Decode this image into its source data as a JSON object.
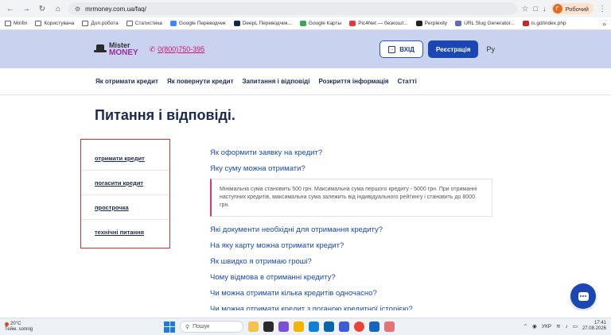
{
  "browser": {
    "url": "mrmoney.com.ua/faq/",
    "profile_initial": "Г",
    "profile_label": "Робочий",
    "bookmarks": [
      {
        "label": "Minfin",
        "kind": "folder"
      },
      {
        "label": "Користувача",
        "kind": "folder"
      },
      {
        "label": "Доп.робота",
        "kind": "folder"
      },
      {
        "label": "Статистика",
        "kind": "folder"
      },
      {
        "label": "Google Переводчик",
        "kind": "site",
        "color": "#4285f4"
      },
      {
        "label": "DeepL Переводчик...",
        "kind": "site",
        "color": "#0f2b46"
      },
      {
        "label": "Google Карты",
        "kind": "site",
        "color": "#34a853"
      },
      {
        "label": "Pic4Net — безкошт...",
        "kind": "site",
        "color": "#e53935"
      },
      {
        "label": "Perplexity",
        "kind": "site",
        "color": "#222222"
      },
      {
        "label": "URL Slug Generator...",
        "kind": "site",
        "color": "#5c6bc0"
      },
      {
        "label": "is.gd/index.php",
        "kind": "site",
        "color": "#c62828"
      }
    ]
  },
  "header": {
    "logo_line1": "Mister",
    "logo_line2": "MONEY",
    "phone": "0(800)750-395",
    "login_label": "ВХІД",
    "register_label": "Реєстрація",
    "lang_label": "Ру"
  },
  "nav": [
    "Як отримати кредит",
    "Як повернути кредит",
    "Запитання і відповіді",
    "Розкриття інформація",
    "Статті"
  ],
  "page": {
    "title": "Питання і відповіді.",
    "categories": [
      "отримати кредит",
      "погасити кредит",
      "прострочка",
      "технічні питання"
    ],
    "questions_top": [
      "Як оформити заявку на кредит?",
      "Яку суму можна отримати?"
    ],
    "answer": "Мінімальна сума становить 500 грн. Максимальна сума першого кредиту - 5000 грн. При отриманні наступних кредитів, максимальна сума залежить від індивідуального рейтингу і становить до 8000 грн.",
    "questions_bottom": [
      "Які документи необхідні для отримання кредиту?",
      "На яку карту можна отримати кредит?",
      "Як швидко я отримаю гроші?",
      "Чому відмова в отриманні кредиту?",
      "Чи можна отримати кілька кредитів одночасно?",
      "Чи можна отримати кредит з поганою кредитної історією?"
    ]
  },
  "taskbar": {
    "weather_temp": "20°C",
    "weather_desc": "Тейм. sonnig",
    "search_placeholder": "Пошук",
    "lang": "УКР",
    "time": "17:41",
    "date": "27.08.2026"
  },
  "colors": {
    "header_bg": "#c9d2ef",
    "brand_blue": "#1a47b3",
    "accent_pink": "#d23b78",
    "highlight_red": "#d32f2f"
  }
}
